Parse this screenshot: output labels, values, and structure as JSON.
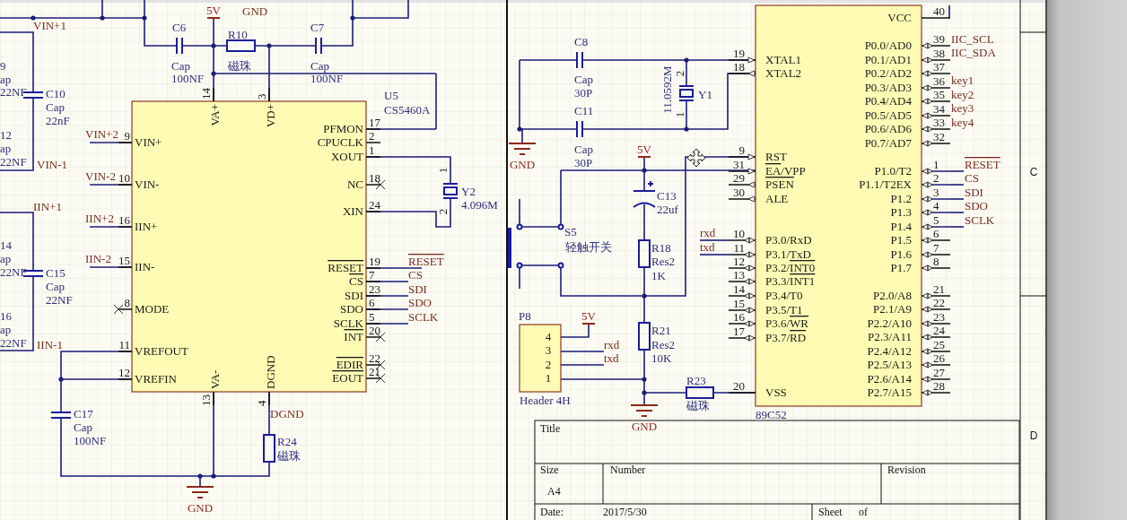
{
  "left_sheet": {
    "edge_labels": [
      "9",
      "ap",
      "22NF",
      "12",
      "ap",
      "22NF",
      "14",
      "ap",
      "22NF",
      "16",
      "ap",
      "22NF"
    ],
    "net_labels": [
      {
        "text": "VIN+1",
        "overline": false
      },
      {
        "text": "VIN-1",
        "overline": false
      },
      {
        "text": "IIN+1",
        "overline": false
      },
      {
        "text": "IIN-1",
        "overline": false
      },
      {
        "text": "VIN+2",
        "overline": false
      },
      {
        "text": "VIN-2",
        "overline": false
      },
      {
        "text": "IIN+2",
        "overline": false
      },
      {
        "text": "IIN-2",
        "overline": false
      },
      {
        "text": "GND",
        "overline": false
      },
      {
        "text": "RESET",
        "overline": true
      },
      {
        "text": "CS",
        "overline": false
      },
      {
        "text": "SDI",
        "overline": false
      },
      {
        "text": "SDO",
        "overline": false
      },
      {
        "text": "SCLK",
        "overline": false
      },
      {
        "text": "DGND",
        "overline": false
      }
    ],
    "power_ports": [
      {
        "kind": "power",
        "label": "5V"
      },
      {
        "kind": "ground",
        "label": "GND"
      }
    ],
    "components": [
      {
        "designator": "C6",
        "comment": "Cap",
        "value": "100NF"
      },
      {
        "designator": "R10",
        "comment": "磁珠"
      },
      {
        "designator": "C7",
        "comment": "Cap",
        "value": "100NF"
      },
      {
        "designator": "C10",
        "comment": "Cap",
        "value": "22nF"
      },
      {
        "designator": "C15",
        "comment": "Cap",
        "value": "22NF"
      },
      {
        "designator": "C17",
        "comment": "Cap",
        "value": "100NF"
      },
      {
        "designator": "R24",
        "comment": "磁珠"
      },
      {
        "designator": "Y2",
        "comment": "4.096M",
        "pin_numbers": [
          "1",
          "2"
        ]
      }
    ],
    "u5": {
      "designator": "U5",
      "part": "CS5460A",
      "pins": [
        {
          "number": "14",
          "name": "VA+",
          "overline": false,
          "no_connect": false
        },
        {
          "number": "3",
          "name": "VD+",
          "overline": false,
          "no_connect": false
        },
        {
          "number": "9",
          "name": "VIN+",
          "overline": false,
          "no_connect": false
        },
        {
          "number": "10",
          "name": "VIN-",
          "overline": false,
          "no_connect": false
        },
        {
          "number": "16",
          "name": "IIN+",
          "overline": false,
          "no_connect": false
        },
        {
          "number": "15",
          "name": "IIN-",
          "overline": false,
          "no_connect": false
        },
        {
          "number": "8",
          "name": "MODE",
          "overline": false,
          "no_connect": true
        },
        {
          "number": "11",
          "name": "VREFOUT",
          "overline": false,
          "no_connect": false
        },
        {
          "number": "12",
          "name": "VREFIN",
          "overline": false,
          "no_connect": false
        },
        {
          "number": "17",
          "name": "PFMON",
          "overline": false,
          "no_connect": false
        },
        {
          "number": "2",
          "name": "CPUCLK",
          "overline": false,
          "no_connect": false
        },
        {
          "number": "1",
          "name": "XOUT",
          "overline": false,
          "no_connect": false
        },
        {
          "number": "18",
          "name": "NC",
          "overline": false,
          "no_connect": true
        },
        {
          "number": "24",
          "name": "XIN",
          "overline": false,
          "no_connect": false
        },
        {
          "number": "19",
          "name": "RESET",
          "overline": true,
          "no_connect": false
        },
        {
          "number": "7",
          "name": "CS",
          "overline": true,
          "no_connect": false
        },
        {
          "number": "23",
          "name": "SDI",
          "overline": false,
          "no_connect": false
        },
        {
          "number": "6",
          "name": "SDO",
          "overline": false,
          "no_connect": false
        },
        {
          "number": "5",
          "name": "SCLK",
          "overline": false,
          "no_connect": false
        },
        {
          "number": "20",
          "name": "INT",
          "overline": true,
          "no_connect": true
        },
        {
          "number": "22",
          "name": "EDIR",
          "overline": true,
          "no_connect": true
        },
        {
          "number": "21",
          "name": "EOUT",
          "overline": true,
          "no_connect": true
        },
        {
          "number": "13",
          "name": "VA-",
          "overline": false,
          "no_connect": false
        },
        {
          "number": "4",
          "name": "DGND",
          "overline": false,
          "no_connect": false
        }
      ]
    }
  },
  "right_sheet": {
    "components": [
      {
        "designator": "C8",
        "comment": "Cap",
        "value": "30P"
      },
      {
        "designator": "C11",
        "comment": "Cap",
        "value": "30P"
      },
      {
        "designator": "Y1",
        "comment": "11.0592M",
        "pin_numbers": [
          "2",
          "1"
        ]
      },
      {
        "designator": "S5",
        "comment": "轻触开关"
      },
      {
        "designator": "C13",
        "comment": "22uf"
      },
      {
        "designator": "R18",
        "comment": "Res2",
        "value": "1K"
      },
      {
        "designator": "R21",
        "comment": "Res2",
        "value": "10K"
      },
      {
        "designator": "P8",
        "comment": "Header 4H",
        "pin_numbers": [
          "4",
          "3",
          "2",
          "1"
        ]
      },
      {
        "designator": "R23",
        "comment": "磁珠"
      }
    ],
    "power_ports": [
      {
        "kind": "ground",
        "label": "GND"
      },
      {
        "kind": "power",
        "label": "5V"
      },
      {
        "kind": "power",
        "label": "5V"
      },
      {
        "kind": "ground",
        "label": "GND"
      }
    ],
    "net_labels": [
      {
        "text": "rxd",
        "overline": false
      },
      {
        "text": "txd",
        "overline": false
      },
      {
        "text": "rxd",
        "overline": false
      },
      {
        "text": "txd",
        "overline": false
      },
      {
        "text": "IIC_SCL",
        "overline": false
      },
      {
        "text": "IIC_SDA",
        "overline": false
      },
      {
        "text": "key1",
        "overline": false
      },
      {
        "text": "key2",
        "overline": false
      },
      {
        "text": "key3",
        "overline": false
      },
      {
        "text": "key4",
        "overline": false
      },
      {
        "text": "RESET",
        "overline": true
      },
      {
        "text": "CS",
        "overline": false
      },
      {
        "text": "SDI",
        "overline": false
      },
      {
        "text": "SDO",
        "overline": false
      },
      {
        "text": "SCLK",
        "overline": false
      }
    ],
    "mcu": {
      "part": "89C52",
      "left_pins": [
        {
          "number": "19",
          "kind": "input",
          "name": [
            {
              "text": "XTAL1",
              "overline": false
            }
          ]
        },
        {
          "number": "18",
          "kind": "output",
          "name": [
            {
              "text": "XTAL2",
              "overline": false
            }
          ]
        },
        {
          "number": "9",
          "kind": "input",
          "name": [
            {
              "text": "RST",
              "overline": false
            }
          ]
        },
        {
          "number": "31",
          "kind": "input",
          "name": [
            {
              "text": "EA",
              "overline": true
            },
            {
              "text": "/VPP",
              "overline": false
            }
          ]
        },
        {
          "number": "29",
          "kind": "output",
          "name": [
            {
              "text": "PSEN",
              "overline": true
            }
          ]
        },
        {
          "number": "30",
          "kind": "output",
          "name": [
            {
              "text": "ALE",
              "overline": false
            }
          ]
        },
        {
          "number": "10",
          "kind": "io",
          "name": [
            {
              "text": "P3.0/RxD",
              "overline": false
            }
          ]
        },
        {
          "number": "11",
          "kind": "io",
          "name": [
            {
              "text": "P3.1/TxD",
              "overline": false
            }
          ]
        },
        {
          "number": "12",
          "kind": "io",
          "name": [
            {
              "text": "P3.2/",
              "overline": false
            },
            {
              "text": "INT0",
              "overline": true
            }
          ]
        },
        {
          "number": "13",
          "kind": "io",
          "name": [
            {
              "text": "P3.3/",
              "overline": false
            },
            {
              "text": "INT1",
              "overline": true
            }
          ]
        },
        {
          "number": "14",
          "kind": "io",
          "name": [
            {
              "text": "P3.4/T0",
              "overline": false
            }
          ]
        },
        {
          "number": "15",
          "kind": "io",
          "name": [
            {
              "text": "P3.5/T1",
              "overline": false
            }
          ]
        },
        {
          "number": "16",
          "kind": "io",
          "name": [
            {
              "text": "P3.6/",
              "overline": false
            },
            {
              "text": "WR",
              "overline": true
            }
          ]
        },
        {
          "number": "17",
          "kind": "io",
          "name": [
            {
              "text": "P3.7/",
              "overline": false
            },
            {
              "text": "RD",
              "overline": true
            }
          ]
        },
        {
          "number": "20",
          "kind": "passive",
          "name": [
            {
              "text": "VSS",
              "overline": false
            }
          ]
        }
      ],
      "right_pins": [
        {
          "number": "40",
          "kind": "passive",
          "name": "VCC"
        },
        {
          "number": "39",
          "kind": "io",
          "name": "P0.0/AD0"
        },
        {
          "number": "38",
          "kind": "io",
          "name": "P0.1/AD1"
        },
        {
          "number": "37",
          "kind": "io",
          "name": "P0.2/AD2"
        },
        {
          "number": "36",
          "kind": "io",
          "name": "P0.3/AD3"
        },
        {
          "number": "35",
          "kind": "io",
          "name": "P0.4/AD4"
        },
        {
          "number": "34",
          "kind": "io",
          "name": "P0.5/AD5"
        },
        {
          "number": "33",
          "kind": "io",
          "name": "P0.6/AD6"
        },
        {
          "number": "32",
          "kind": "io",
          "name": "P0.7/AD7"
        },
        {
          "number": "1",
          "kind": "io",
          "name": "P1.0/T2"
        },
        {
          "number": "2",
          "kind": "io",
          "name": "P1.1/T2EX"
        },
        {
          "number": "3",
          "kind": "io",
          "name": "P1.2"
        },
        {
          "number": "4",
          "kind": "io",
          "name": "P1.3"
        },
        {
          "number": "5",
          "kind": "io",
          "name": "P1.4"
        },
        {
          "number": "6",
          "kind": "io",
          "name": "P1.5"
        },
        {
          "number": "7",
          "kind": "io",
          "name": "P1.6"
        },
        {
          "number": "8",
          "kind": "io",
          "name": "P1.7"
        },
        {
          "number": "21",
          "kind": "io",
          "name": "P2.0/A8"
        },
        {
          "number": "22",
          "kind": "io",
          "name": "P2.1/A9"
        },
        {
          "number": "23",
          "kind": "io",
          "name": "P2.2/A10"
        },
        {
          "number": "24",
          "kind": "io",
          "name": "P2.3/A11"
        },
        {
          "number": "25",
          "kind": "io",
          "name": "P2.4/A12"
        },
        {
          "number": "26",
          "kind": "io",
          "name": "P2.5/A13"
        },
        {
          "number": "27",
          "kind": "io",
          "name": "P2.6/A14"
        },
        {
          "number": "28",
          "kind": "io",
          "name": "P2.7/A15"
        }
      ]
    }
  },
  "zone_labels": [
    "C",
    "D"
  ],
  "title_block": {
    "title_label": "Title",
    "size_label": "Size",
    "size": "A4",
    "number_label": "Number",
    "revision_label": "Revision",
    "date_label": "Date:",
    "date": "2017/5/30",
    "sheet_label": "Sheet",
    "of_label": "of"
  }
}
